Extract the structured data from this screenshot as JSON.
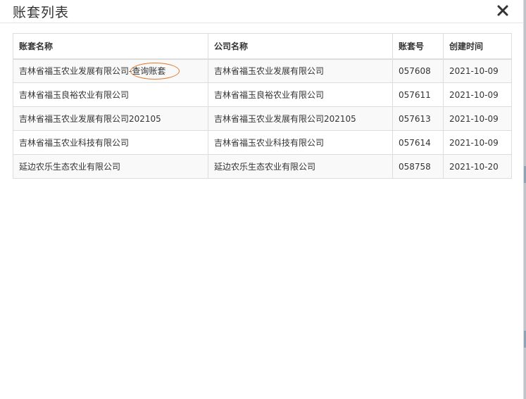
{
  "modal": {
    "title": "账套列表"
  },
  "table": {
    "headers": {
      "account_name": "账套名称",
      "company_name": "公司名称",
      "account_no": "账套号",
      "created_at": "创建时间"
    },
    "rows": [
      {
        "account_name": "吉林省福玉农业发展有限公司-查询账套",
        "company_name": "吉林省福玉农业发展有限公司",
        "account_no": "057608",
        "created_at": "2021-10-09"
      },
      {
        "account_name": "吉林省福玉良裕农业有限公司",
        "company_name": "吉林省福玉良裕农业有限公司",
        "account_no": "057611",
        "created_at": "2021-10-09"
      },
      {
        "account_name": "吉林省福玉农业发展有限公司202105",
        "company_name": "吉林省福玉农业发展有限公司202105",
        "account_no": "057613",
        "created_at": "2021-10-09"
      },
      {
        "account_name": "吉林省福玉农业科技有限公司",
        "company_name": "吉林省福玉农业科技有限公司",
        "account_no": "057614",
        "created_at": "2021-10-09"
      },
      {
        "account_name": "延边农乐生态农业有限公司",
        "company_name": "延边农乐生态农业有限公司",
        "account_no": "058758",
        "created_at": "2021-10-20"
      }
    ]
  },
  "colors": {
    "annotation": "#e07a2e",
    "border": "#dddddd",
    "stripe": "#f9f9f9"
  },
  "icons": {
    "close": "close-icon"
  }
}
